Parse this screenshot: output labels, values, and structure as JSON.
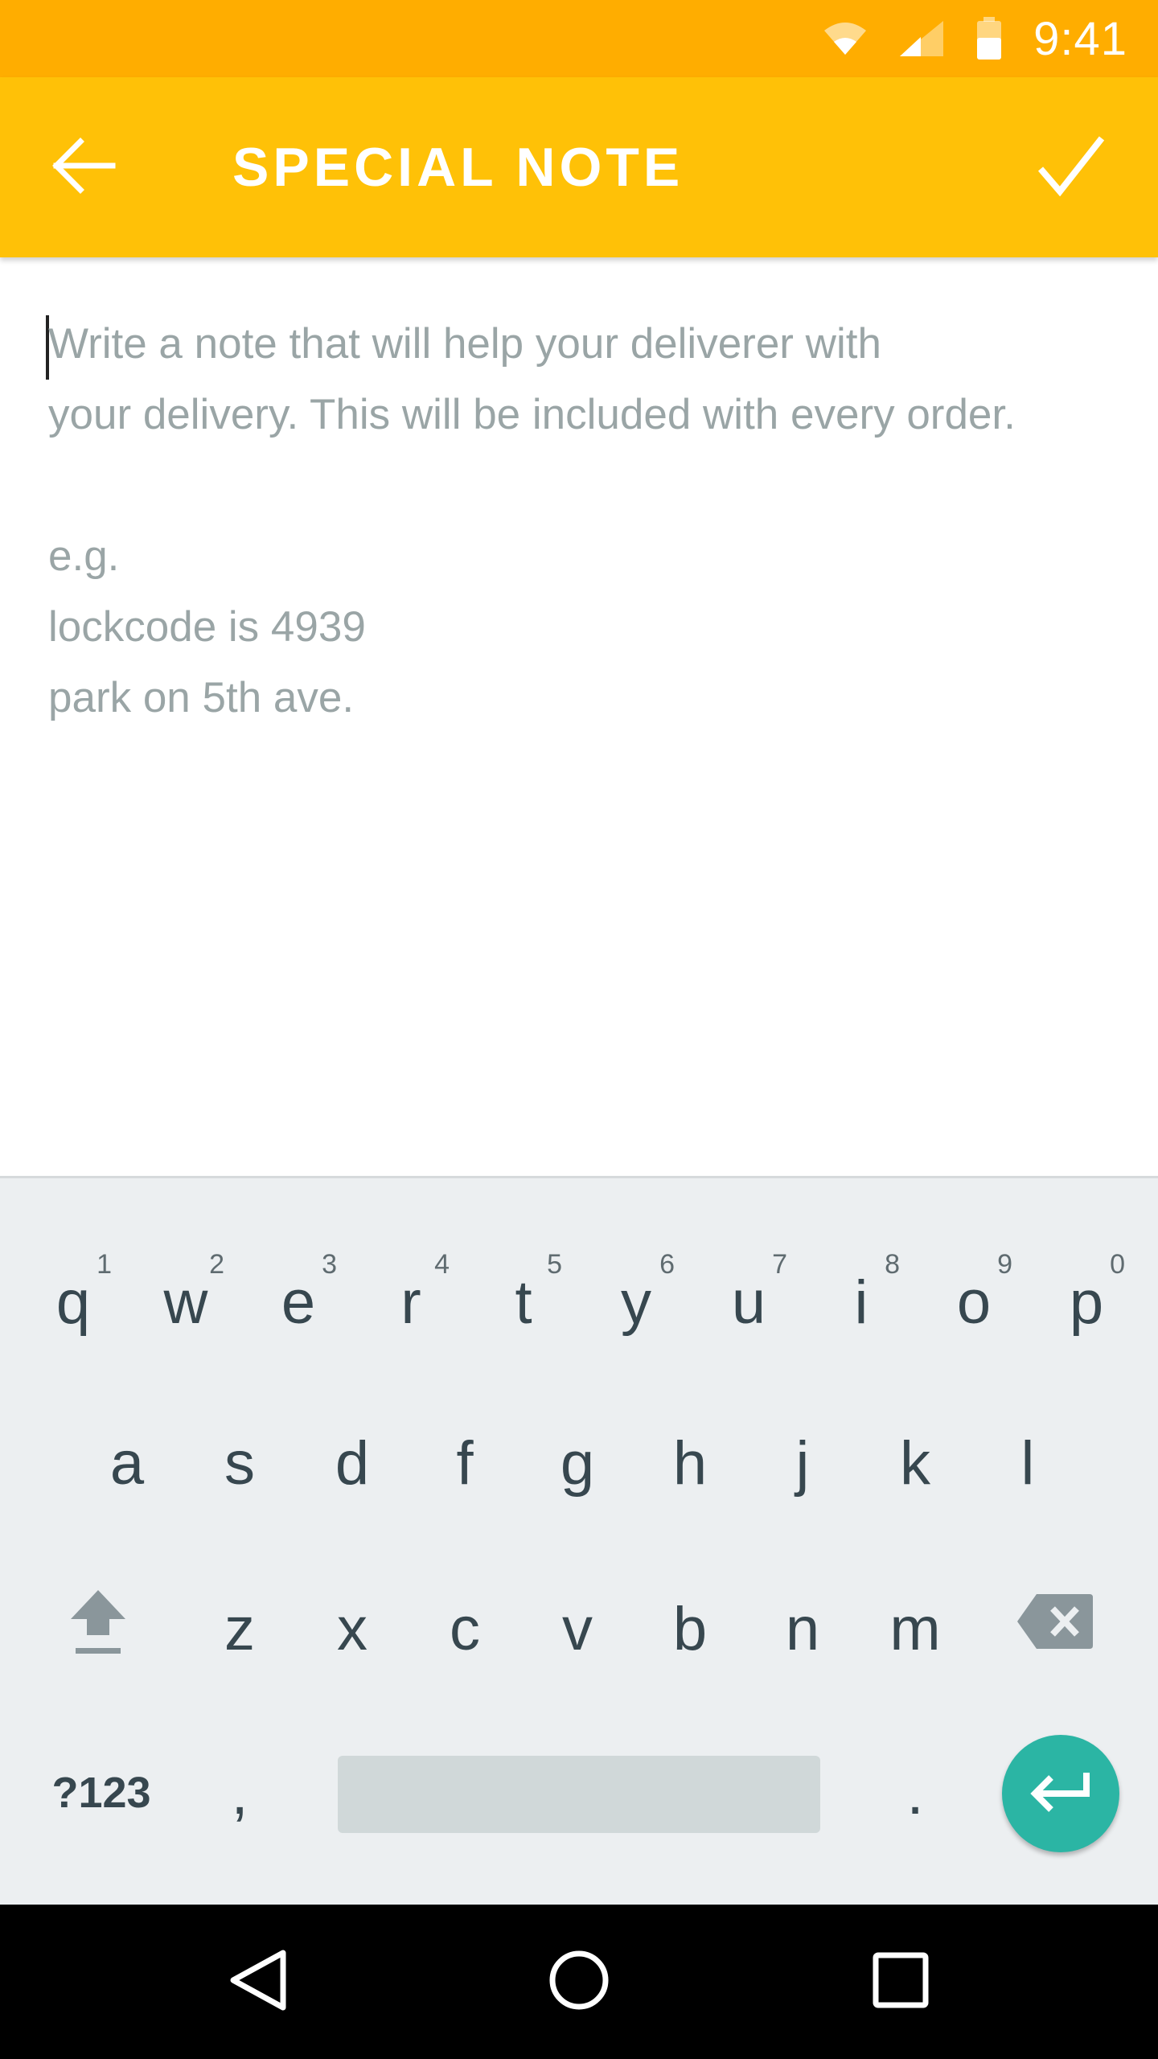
{
  "status_bar": {
    "time": "9:41",
    "icons": [
      "wifi-icon",
      "signal-icon",
      "battery-icon"
    ],
    "color": "#FFAD00"
  },
  "app_bar": {
    "title": "SPECIAL NOTE",
    "back_icon": "arrow-left-icon",
    "confirm_icon": "check-icon",
    "color": "#FFC107"
  },
  "note": {
    "placeholder": "Write a note that will help your deliverer with\nyour delivery. This will be included with every order.\n\ne.g.\nlockcode is 4939\npark on 5th ave.",
    "value": ""
  },
  "keyboard": {
    "row1": [
      {
        "key": "q",
        "hint": "1"
      },
      {
        "key": "w",
        "hint": "2"
      },
      {
        "key": "e",
        "hint": "3"
      },
      {
        "key": "r",
        "hint": "4"
      },
      {
        "key": "t",
        "hint": "5"
      },
      {
        "key": "y",
        "hint": "6"
      },
      {
        "key": "u",
        "hint": "7"
      },
      {
        "key": "i",
        "hint": "8"
      },
      {
        "key": "o",
        "hint": "9"
      },
      {
        "key": "p",
        "hint": "0"
      }
    ],
    "row2": [
      "a",
      "s",
      "d",
      "f",
      "g",
      "h",
      "j",
      "k",
      "l"
    ],
    "row3": [
      "z",
      "x",
      "c",
      "v",
      "b",
      "n",
      "m"
    ],
    "symbols_label": "?123",
    "comma": ",",
    "period": ".",
    "shift_icon": "shift-icon",
    "backspace_icon": "backspace-icon",
    "enter_icon": "enter-icon",
    "enter_color": "#2BB5A4"
  },
  "nav_bar": {
    "icons": [
      "back-triangle-icon",
      "home-circle-icon",
      "recents-square-icon"
    ]
  }
}
